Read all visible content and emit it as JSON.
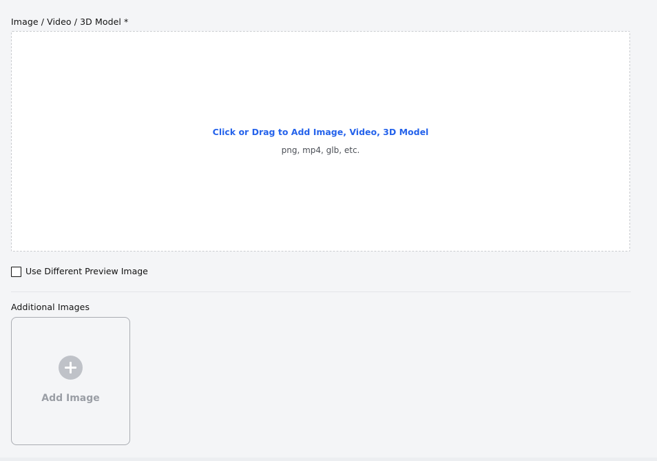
{
  "media_field": {
    "label": "Image / Video / 3D Model *",
    "dropzone_title": "Click or Drag to Add Image, Video, 3D Model",
    "dropzone_hint": "png, mp4, glb, etc."
  },
  "preview_option": {
    "label": "Use Different Preview Image",
    "checked": false
  },
  "additional_images": {
    "label": "Additional Images",
    "add_button_label": "Add Image",
    "add_icon": "plus-circle-icon"
  },
  "colors": {
    "accent": "#2563eb",
    "background": "#f4f5f7",
    "muted": "#9a9ea5"
  }
}
